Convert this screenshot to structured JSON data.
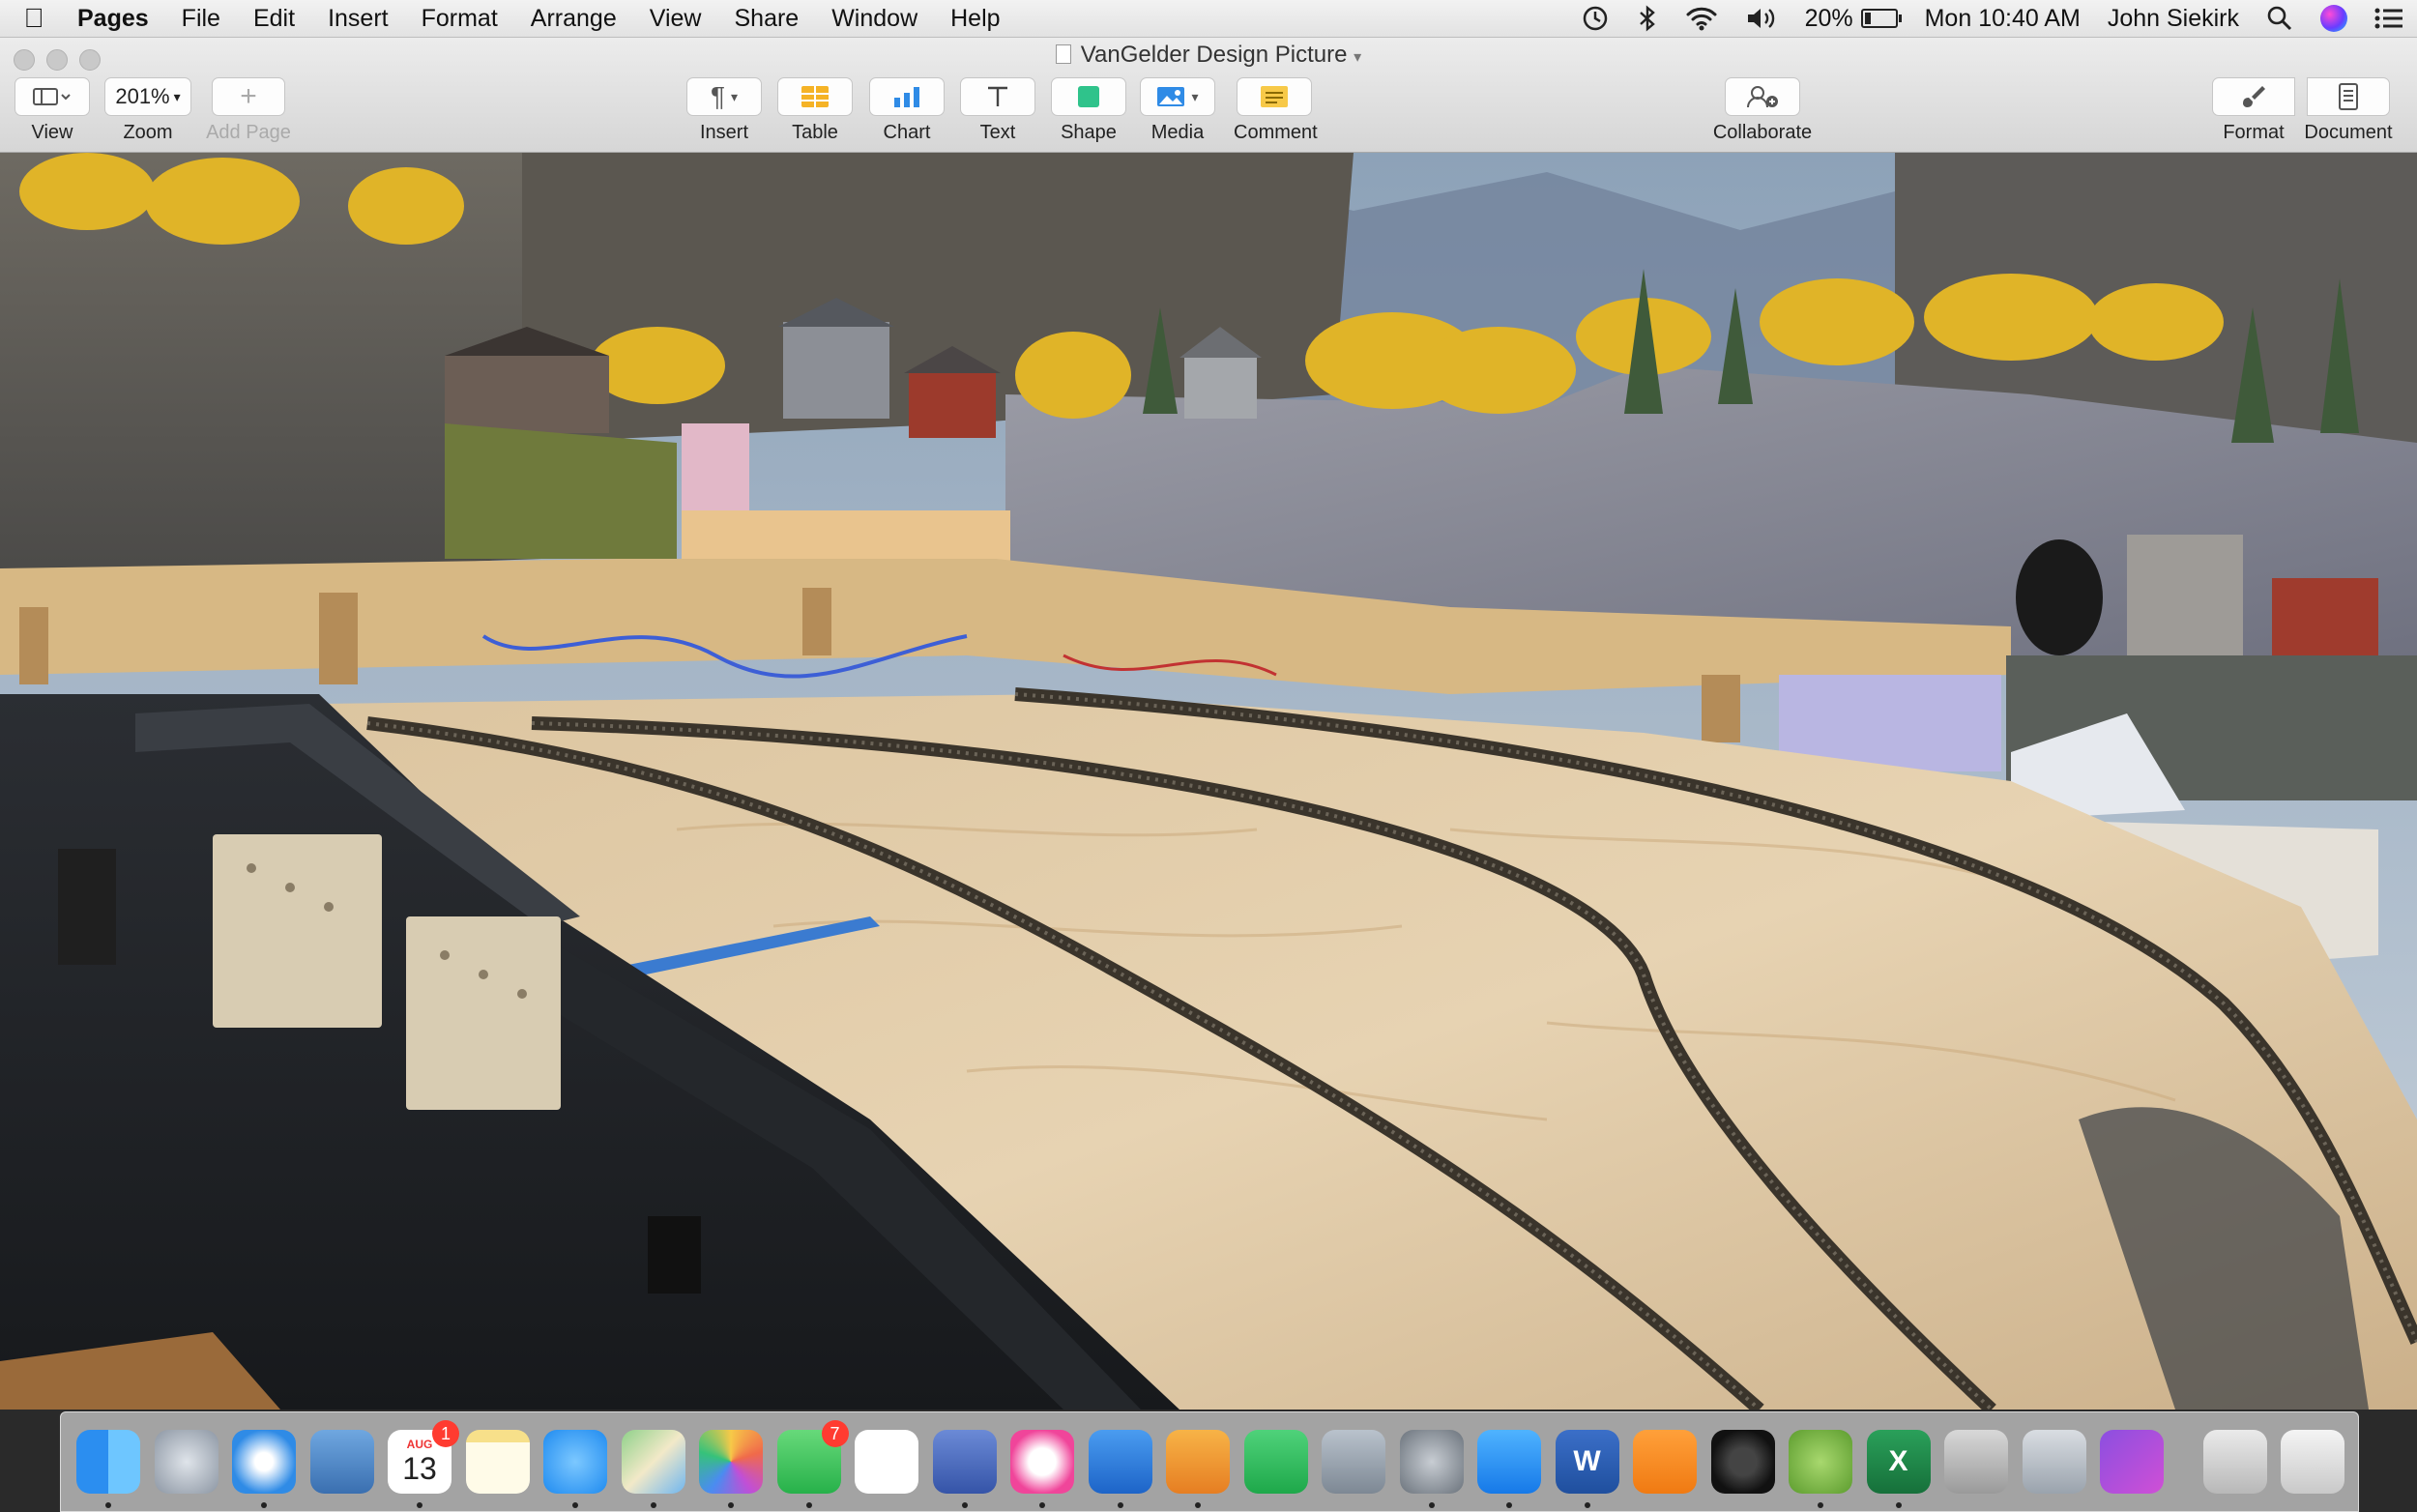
{
  "menubar": {
    "apple_icon": "apple-icon",
    "app_name": "Pages",
    "menus": [
      "File",
      "Edit",
      "Insert",
      "Format",
      "Arrange",
      "View",
      "Share",
      "Window",
      "Help"
    ],
    "status": {
      "battery_percent": "20%",
      "battery_level": 0.2,
      "clock": "Mon 10:40 AM",
      "user": "John Siekirk"
    }
  },
  "window": {
    "title": "VanGelder Design Picture",
    "toolbar": {
      "view_label": "View",
      "zoom_value": "201%",
      "zoom_label": "Zoom",
      "add_page_label": "Add Page",
      "insert_label": "Insert",
      "table_label": "Table",
      "chart_label": "Chart",
      "text_label": "Text",
      "shape_label": "Shape",
      "media_label": "Media",
      "comment_label": "Comment",
      "collaborate_label": "Collaborate",
      "format_label": "Format",
      "document_label": "Document"
    }
  },
  "colors": {
    "table_icon": "#f5b326",
    "chart_icon": "#2f8be6",
    "shape_icon": "#2fc38b",
    "comment_icon": "#f7c948"
  },
  "dock": {
    "calendar_month": "AUG",
    "calendar_day": "13",
    "calendar_badge": "1",
    "facetime_badge": "7",
    "excel_letter": "X",
    "word_letter": "W"
  }
}
